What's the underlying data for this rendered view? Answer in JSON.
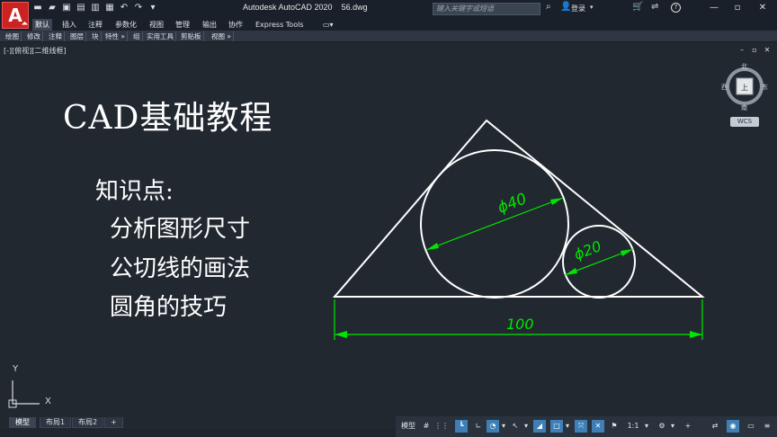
{
  "titlebar": {
    "app_logo": "A",
    "window_title": "Autodesk AutoCAD 2020    56.dwg",
    "search_placeholder": "键入关键字或短语",
    "login_label": "登录",
    "login_caret": "▾",
    "win_minimize": "—",
    "win_restore": "▫",
    "win_close": "✕",
    "qat": [
      "▬",
      "▰",
      "▣",
      "▤",
      "▥",
      "▦",
      "↶",
      "↷",
      "▾"
    ]
  },
  "ribbon_tabs": [
    {
      "label": "默认",
      "active": true
    },
    {
      "label": "插入"
    },
    {
      "label": "注释"
    },
    {
      "label": "参数化"
    },
    {
      "label": "视图"
    },
    {
      "label": "管理"
    },
    {
      "label": "输出"
    },
    {
      "label": "协作"
    },
    {
      "label": "Express Tools"
    },
    {
      "label": "▭▾"
    }
  ],
  "panels": [
    "绘图",
    "修改",
    "注释",
    "图层",
    "块",
    "特性 »",
    "组",
    "实用工具",
    "剪贴板",
    "视图 »"
  ],
  "viewport": {
    "label": "[-][俯视][二维线框]",
    "ctl_minimize": "–",
    "ctl_restore": "▫",
    "ctl_close": "✕"
  },
  "lesson": {
    "title": "CAD基础教程",
    "heading": "知识点:",
    "points": [
      "分析图形尺寸",
      "公切线的画法",
      "圆角的技巧"
    ]
  },
  "dimensions": {
    "large_circle": "ϕ40",
    "small_circle": "ϕ20",
    "base_length": "100"
  },
  "viewcube": {
    "north": "北",
    "south": "南",
    "east": "东",
    "west": "西",
    "face": "上",
    "wcs": "WCS"
  },
  "ucs": {
    "x": "X",
    "y": "Y"
  },
  "layout_tabs": [
    {
      "label": "模型",
      "active": true
    },
    {
      "label": "布局1"
    },
    {
      "label": "布局2"
    },
    {
      "label": "+"
    }
  ],
  "status_bar": [
    {
      "label": "模型"
    },
    {
      "label": "#"
    },
    {
      "label": "⋮⋮"
    },
    {
      "label": "┗",
      "on": true
    },
    {
      "label": "∟"
    },
    {
      "label": "◔",
      "on": true
    },
    {
      "label": "▾"
    },
    {
      "label": "↖"
    },
    {
      "label": "▾"
    },
    {
      "label": "◢",
      "on": true
    },
    {
      "label": "□",
      "on": true
    },
    {
      "label": "▾"
    },
    {
      "label": "⤧",
      "on": true
    },
    {
      "label": "✕",
      "on": true
    },
    {
      "label": "⚑"
    },
    {
      "label": "1:1"
    },
    {
      "label": "▾"
    },
    {
      "label": "⚙"
    },
    {
      "label": "▾"
    },
    {
      "label": "+"
    },
    {
      "label": "⇄"
    },
    {
      "label": "◉",
      "on": true
    },
    {
      "label": "▭"
    },
    {
      "label": "≡"
    }
  ],
  "colors": {
    "drawing_line": "#ffffff",
    "dimension": "#00e600",
    "background": "#212830"
  }
}
